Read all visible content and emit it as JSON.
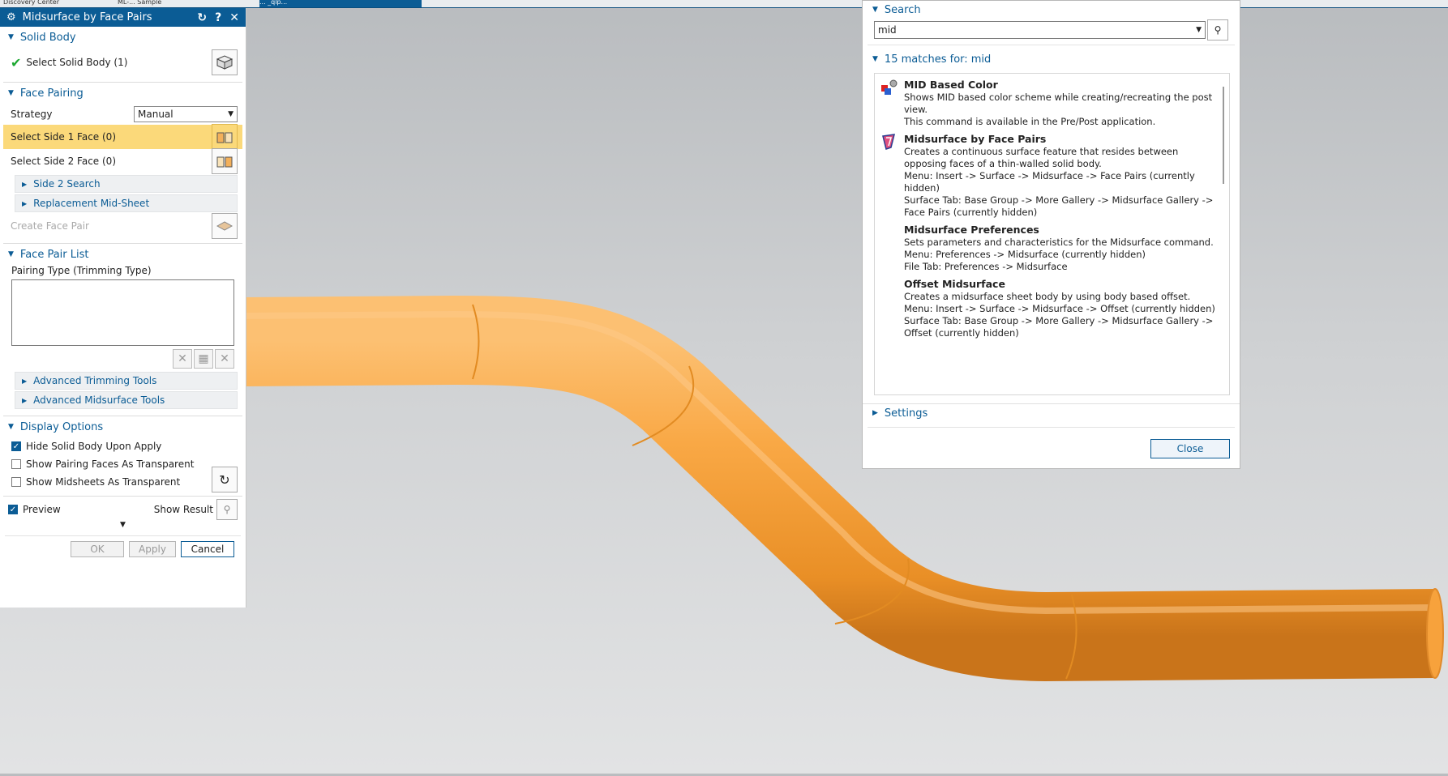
{
  "tabs": [
    {
      "label": "Discovery Center"
    },
    {
      "label": "ML-... Sample"
    },
    {
      "label": "... _qlp..."
    }
  ],
  "colors": {
    "accent": "#0b5c95",
    "highlight": "#fbd97a",
    "pipe": "#f7a23c"
  },
  "panel": {
    "title": "Midsurface by Face Pairs",
    "solid_body": {
      "header": "Solid Body",
      "select_label": "Select Solid Body (1)"
    },
    "face_pairing": {
      "header": "Face Pairing",
      "strategy_label": "Strategy",
      "strategy_value": "Manual",
      "side1_label": "Select Side 1 Face (0)",
      "side2_label": "Select Side 2 Face (0)",
      "side2_search": "Side 2 Search",
      "replacement": "Replacement Mid-Sheet",
      "create_pair": "Create Face Pair"
    },
    "face_pair_list": {
      "header": "Face Pair List",
      "pairing_type": "Pairing Type (Trimming Type)",
      "advanced_trimming": "Advanced Trimming Tools",
      "advanced_midsurface": "Advanced Midsurface Tools"
    },
    "display_options": {
      "header": "Display Options",
      "hide_solid": "Hide Solid Body Upon Apply",
      "show_pairing": "Show Pairing Faces As Transparent",
      "show_midsheets": "Show Midsheets As Transparent"
    },
    "preview_label": "Preview",
    "show_result": "Show Result",
    "ok": "OK",
    "apply": "Apply",
    "cancel": "Cancel"
  },
  "search": {
    "header": "Search",
    "query": "mid",
    "matches_header": "15 matches for: mid",
    "results": [
      {
        "title": "MID Based Color",
        "lines": [
          "Shows MID based color scheme while creating/recreating the post view.",
          "This command is available in the Pre/Post application."
        ],
        "icon": "mid-color-icon"
      },
      {
        "title": "Midsurface by Face Pairs",
        "lines": [
          "Creates a continuous surface feature that resides between opposing faces of a thin-walled solid body.",
          "Menu: Insert -> Surface -> Midsurface -> Face Pairs (currently hidden)",
          "Surface Tab: Base Group -> More Gallery -> Midsurface Gallery -> Face Pairs (currently hidden)"
        ],
        "icon": "midsurface-icon"
      },
      {
        "title": "Midsurface Preferences",
        "lines": [
          "Sets parameters and characteristics for the Midsurface command.",
          "Menu: Preferences -> Midsurface (currently hidden)",
          "File Tab: Preferences -> Midsurface"
        ],
        "icon": ""
      },
      {
        "title": "Offset Midsurface",
        "lines": [
          "Creates a midsurface sheet body by using body based offset.",
          "Menu: Insert -> Surface -> Midsurface -> Offset (currently hidden)",
          "Surface Tab: Base Group -> More Gallery -> Midsurface Gallery -> Offset (currently hidden)"
        ],
        "icon": ""
      }
    ],
    "settings": "Settings",
    "close": "Close"
  }
}
